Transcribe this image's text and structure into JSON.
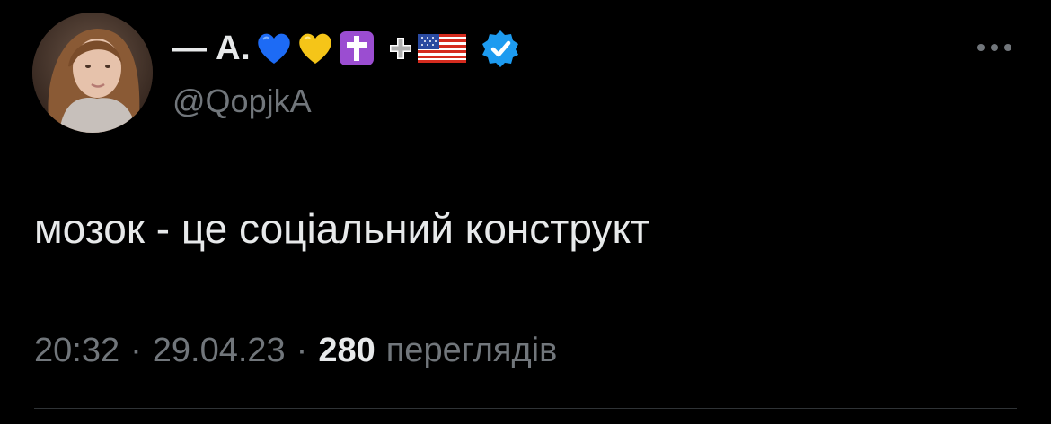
{
  "author": {
    "display_name": "— A.",
    "handle": "@QopjkA",
    "name_emojis": [
      "blue-heart",
      "yellow-heart",
      "latin-cross",
      "cross-mark",
      "us-flag"
    ],
    "verified": true,
    "verified_color": "#1d9bf0"
  },
  "tweet": {
    "text": "мозок - це соціальний конструкт",
    "time": "20:32",
    "date": "29.04.23",
    "separator": "·",
    "views_count": "280",
    "views_label": "переглядів"
  },
  "icons": {
    "more": "more-options-icon"
  },
  "colors": {
    "background": "#000000",
    "primary_text": "#e7e9ea",
    "secondary_text": "#71767b",
    "divider": "#2f3336"
  }
}
